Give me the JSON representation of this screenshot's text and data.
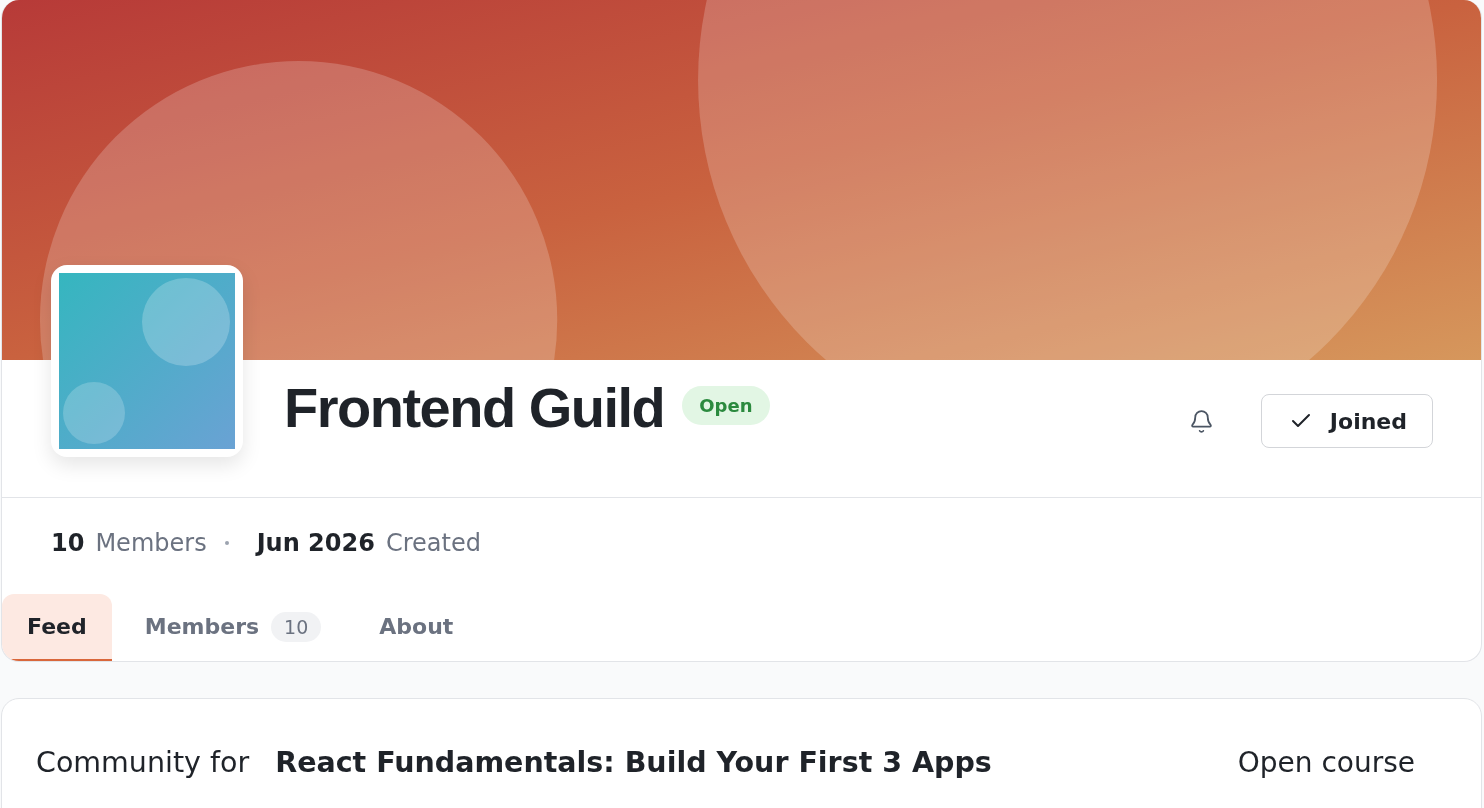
{
  "group": {
    "title": "Frontend Guild",
    "badge": "Open"
  },
  "actions": {
    "join_button": {
      "label": "Joined",
      "joined": true
    }
  },
  "stats": [
    {
      "value": "10",
      "label": "Members"
    },
    {
      "value": "Jun 2026",
      "label": "Created"
    }
  ],
  "tabs": [
    {
      "label": "Feed",
      "selected": true
    },
    {
      "label": "Members",
      "count": "10",
      "selected": false
    },
    {
      "label": "About",
      "selected": false
    }
  ],
  "course_card": {
    "prefix": "Community for",
    "course_title": "React Fundamentals: Build Your First 3 Apps",
    "link": "Open course"
  }
}
